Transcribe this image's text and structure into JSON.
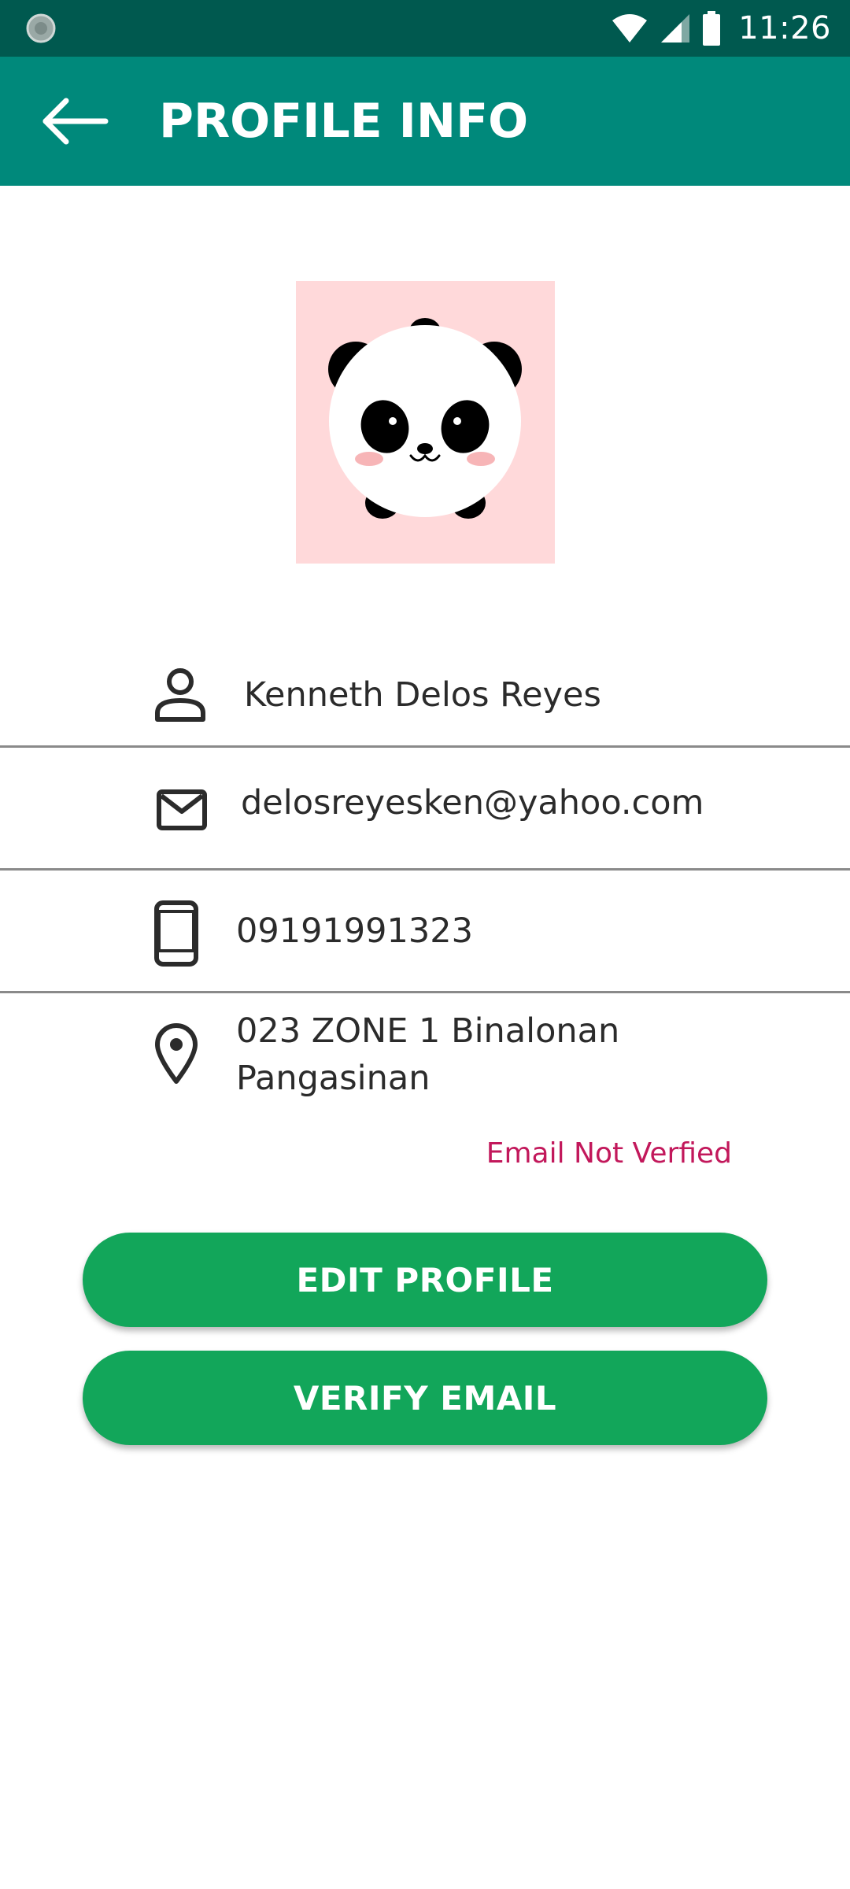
{
  "status_bar": {
    "time": "11:26",
    "background": "#00594f",
    "icons": [
      "app-notification-icon",
      "wifi-icon",
      "signal-icon",
      "battery-icon"
    ]
  },
  "app_bar": {
    "title": "PROFILE INFO",
    "background": "#00897b",
    "back_icon": "arrow-back-icon"
  },
  "profile": {
    "avatar": "panda-avatar",
    "name": "Kenneth Delos Reyes",
    "name_icon": "person-icon",
    "email": "delosreyesken@yahoo.com",
    "email_icon": "mail-icon",
    "phone": "09191991323",
    "phone_icon": "phone-icon",
    "address_line1": "023 ZONE 1 Binalonan",
    "address_line2": "Pangasinan",
    "address_icon": "location-pin-icon"
  },
  "email_status": {
    "text": "Email Not Verfied",
    "color": "#c2185b"
  },
  "buttons": {
    "edit_profile": "EDIT PROFILE",
    "verify_email": "VERIFY EMAIL",
    "color": "#12a65a"
  }
}
